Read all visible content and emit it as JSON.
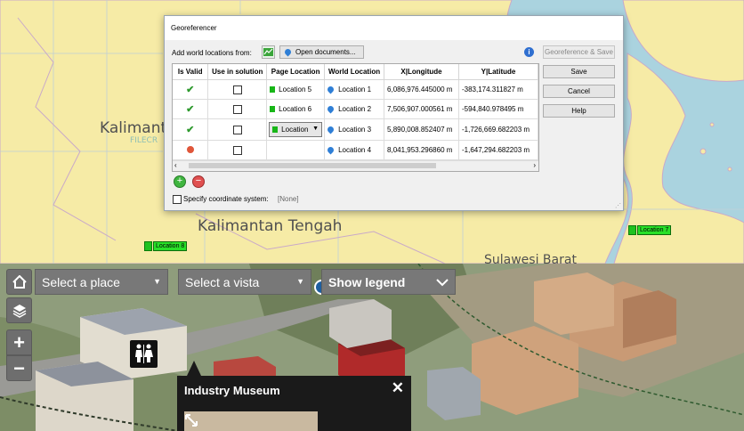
{
  "map": {
    "labels": {
      "kalimantan": "Kalimant",
      "kalimantan_tengah": "Kalimantan Tengah",
      "sulawesi_barat": "Sulawesi Barat",
      "watermark": "FILECR"
    },
    "flags": {
      "location8": "Location 8",
      "location7": "Location 7"
    }
  },
  "dialog": {
    "title": "Georeferencer",
    "add_label": "Add world locations from:",
    "open_documents": "Open documents...",
    "georef_save": "Georeference & Save",
    "save": "Save",
    "cancel": "Cancel",
    "help": "Help",
    "columns": [
      "Is Valid",
      "Use in solution",
      "Page Location",
      "World Location",
      "X|Longitude",
      "Y|Latitude"
    ],
    "rows": [
      {
        "valid": "ok",
        "page": "Location 5",
        "world": "Location 1",
        "x": "6,086,976.445000 m",
        "y": "-383,174.311827 m"
      },
      {
        "valid": "ok",
        "page": "Location 6",
        "world": "Location 2",
        "x": "7,506,907.000561 m",
        "y": "-594,840.978495 m"
      },
      {
        "valid": "ok",
        "page": "Location",
        "world": "Location 3",
        "x": "5,890,008.852407 m",
        "y": "-1,726,669.682203 m"
      },
      {
        "valid": "error",
        "page": "",
        "world": "Location 4",
        "x": "8,041,953.296860 m",
        "y": "-1,647,294.682203 m"
      }
    ],
    "specify_label": "Specify coordinate system:",
    "specify_value": "[None]"
  },
  "viewer": {
    "place_placeholder": "Select a place",
    "vista_placeholder": "Select a vista",
    "legend_label": "Show legend",
    "popup_title": "Industry Museum",
    "close_glyph": "✕",
    "zoom_in": "+",
    "zoom_out": "−"
  },
  "colors": {
    "land": "#f6eba6",
    "sea": "#aad3df",
    "flag_green": "#28e028",
    "toolbar_gray": "#787878"
  }
}
